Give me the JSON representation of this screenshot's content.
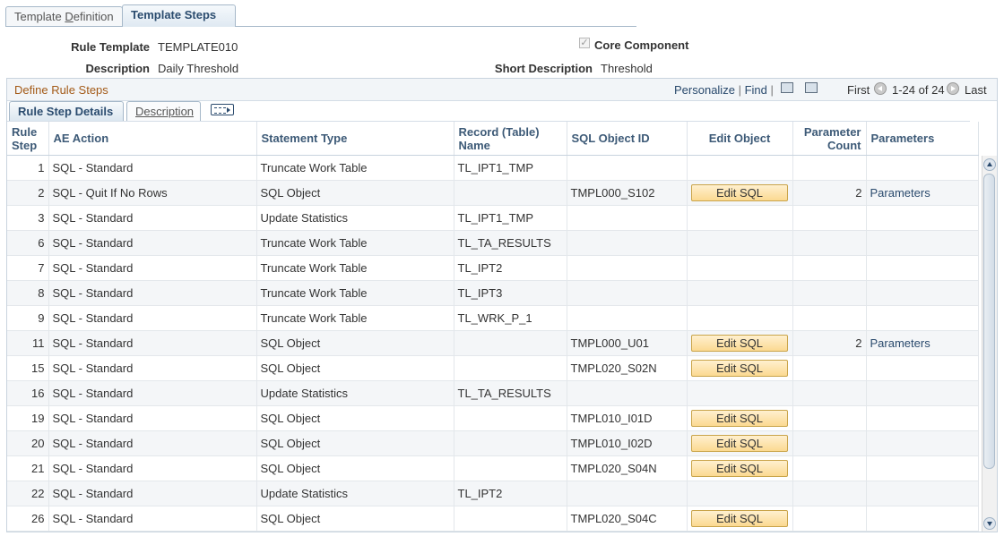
{
  "page_tabs": [
    {
      "label_pre": "Template ",
      "label_ul": "D",
      "label_post": "efinition",
      "active": false
    },
    {
      "label": "Template Steps",
      "active": true
    }
  ],
  "header": {
    "rule_template_label": "Rule Template",
    "rule_template_value": "TEMPLATE010",
    "description_label": "Description",
    "description_value": "Daily Threshold",
    "core_component_label": "Core Component",
    "core_component_checked": true,
    "short_description_label": "Short Description",
    "short_description_value": "Threshold"
  },
  "grid": {
    "title": "Define Rule Steps",
    "personalize": "Personalize",
    "sep": "|",
    "find": "Find",
    "first": "First",
    "range": "1-24 of 24",
    "last": "Last",
    "tabs": [
      "Rule Step Details",
      "Description"
    ],
    "columns": [
      "Rule Step",
      "AE Action",
      "Statement Type",
      "Record (Table) Name",
      "SQL Object ID",
      "Edit Object",
      "Parameter Count",
      "Parameters"
    ],
    "edit_label": "Edit SQL",
    "param_label": "Parameters",
    "rows": [
      {
        "step": "1",
        "action": "SQL - Standard",
        "stype": "Truncate Work Table",
        "record": "TL_IPT1_TMP",
        "sqlid": "",
        "edit": false,
        "pcount": "",
        "params": false
      },
      {
        "step": "2",
        "action": "SQL - Quit If No Rows",
        "stype": "SQL Object",
        "record": "",
        "sqlid": "TMPL000_S102",
        "edit": true,
        "pcount": "2",
        "params": true
      },
      {
        "step": "3",
        "action": "SQL - Standard",
        "stype": "Update Statistics",
        "record": "TL_IPT1_TMP",
        "sqlid": "",
        "edit": false,
        "pcount": "",
        "params": false
      },
      {
        "step": "6",
        "action": "SQL - Standard",
        "stype": "Truncate Work Table",
        "record": "TL_TA_RESULTS",
        "sqlid": "",
        "edit": false,
        "pcount": "",
        "params": false
      },
      {
        "step": "7",
        "action": "SQL - Standard",
        "stype": "Truncate Work Table",
        "record": "TL_IPT2",
        "sqlid": "",
        "edit": false,
        "pcount": "",
        "params": false
      },
      {
        "step": "8",
        "action": "SQL - Standard",
        "stype": "Truncate Work Table",
        "record": "TL_IPT3",
        "sqlid": "",
        "edit": false,
        "pcount": "",
        "params": false
      },
      {
        "step": "9",
        "action": "SQL - Standard",
        "stype": "Truncate Work Table",
        "record": "TL_WRK_P_1",
        "sqlid": "",
        "edit": false,
        "pcount": "",
        "params": false
      },
      {
        "step": "11",
        "action": "SQL - Standard",
        "stype": "SQL Object",
        "record": "",
        "sqlid": "TMPL000_U01",
        "edit": true,
        "pcount": "2",
        "params": true
      },
      {
        "step": "15",
        "action": "SQL - Standard",
        "stype": "SQL Object",
        "record": "",
        "sqlid": "TMPL020_S02N",
        "edit": true,
        "pcount": "",
        "params": false
      },
      {
        "step": "16",
        "action": "SQL - Standard",
        "stype": "Update Statistics",
        "record": "TL_TA_RESULTS",
        "sqlid": "",
        "edit": false,
        "pcount": "",
        "params": false
      },
      {
        "step": "19",
        "action": "SQL - Standard",
        "stype": "SQL Object",
        "record": "",
        "sqlid": "TMPL010_I01D",
        "edit": true,
        "pcount": "",
        "params": false
      },
      {
        "step": "20",
        "action": "SQL - Standard",
        "stype": "SQL Object",
        "record": "",
        "sqlid": "TMPL010_I02D",
        "edit": true,
        "pcount": "",
        "params": false
      },
      {
        "step": "21",
        "action": "SQL - Standard",
        "stype": "SQL Object",
        "record": "",
        "sqlid": "TMPL020_S04N",
        "edit": true,
        "pcount": "",
        "params": false
      },
      {
        "step": "22",
        "action": "SQL - Standard",
        "stype": "Update Statistics",
        "record": "TL_IPT2",
        "sqlid": "",
        "edit": false,
        "pcount": "",
        "params": false
      },
      {
        "step": "26",
        "action": "SQL - Standard",
        "stype": "SQL Object",
        "record": "",
        "sqlid": "TMPL020_S04C",
        "edit": true,
        "pcount": "",
        "params": false
      }
    ]
  },
  "icons": {
    "zoom": "zoom-grid-icon",
    "download": "download-to-excel-icon",
    "show_all_columns": "show-all-columns-icon",
    "first_arrow": "first-arrow-icon",
    "last_arrow": "last-arrow-icon"
  },
  "colors": {
    "grid_title": "#a35a17",
    "link": "#2a4a6d",
    "button_fill": "#fbd991"
  }
}
